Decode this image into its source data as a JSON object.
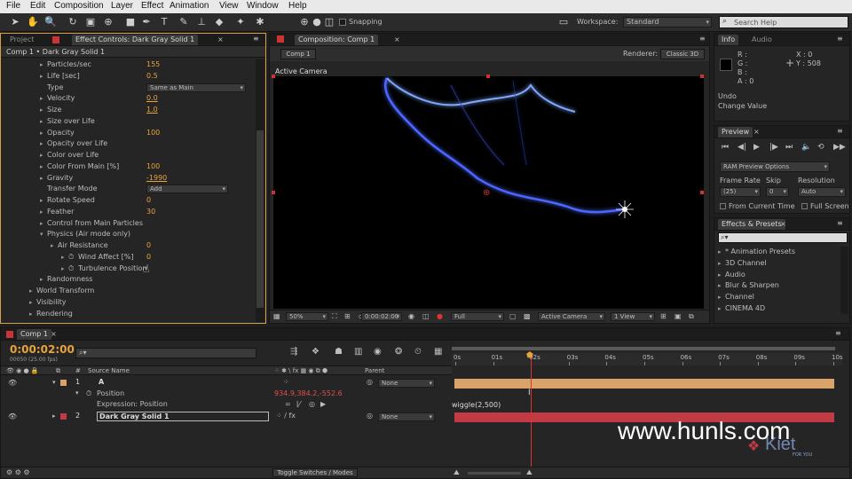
{
  "menu": [
    "File",
    "Edit",
    "Composition",
    "Layer",
    "Effect",
    "Animation",
    "View",
    "Window",
    "Help"
  ],
  "toolbar": {
    "snapping_label": "Snapping",
    "workspace_label": "Workspace:",
    "workspace_value": "Standard",
    "search_placeholder": "Search Help"
  },
  "effect_controls": {
    "tab_project": "Project",
    "tab_effect": "Effect Controls: Dark Gray Solid 1",
    "breadcrumb": "Comp 1 • Dark Gray Solid 1",
    "rows": [
      {
        "label": "Particles/sec",
        "value": "155",
        "indent": 1,
        "twirl": "▸"
      },
      {
        "label": "Life [sec]",
        "value": "0.5",
        "indent": 1,
        "twirl": "▸"
      },
      {
        "label": "Type",
        "value": "",
        "indent": 1,
        "twirl": "",
        "dropdown": "Same as Main"
      },
      {
        "label": "Velocity",
        "value": "0.0",
        "indent": 1,
        "twirl": "▸",
        "under": true
      },
      {
        "label": "Size",
        "value": "1.0",
        "indent": 1,
        "twirl": "▸",
        "under": true
      },
      {
        "label": "Size over Life",
        "value": "",
        "indent": 1,
        "twirl": "▸"
      },
      {
        "label": "Opacity",
        "value": "100",
        "indent": 1,
        "twirl": "▸"
      },
      {
        "label": "Opacity over Life",
        "value": "",
        "indent": 1,
        "twirl": "▸"
      },
      {
        "label": "Color over Life",
        "value": "",
        "indent": 1,
        "twirl": "▸"
      },
      {
        "label": "Color From Main [%]",
        "value": "100",
        "indent": 1,
        "twirl": "▸"
      },
      {
        "label": "Gravity",
        "value": "-1990",
        "indent": 1,
        "twirl": "▸",
        "under": true
      },
      {
        "label": "Transfer Mode",
        "value": "",
        "indent": 1,
        "twirl": "",
        "dropdown": "Add"
      },
      {
        "label": "Rotate Speed",
        "value": "0",
        "indent": 1,
        "twirl": "▸"
      },
      {
        "label": "Feather",
        "value": "30",
        "indent": 1,
        "twirl": "▸"
      },
      {
        "label": "Control from Main Particles",
        "value": "",
        "indent": 1,
        "twirl": "▸"
      },
      {
        "label": "Physics (Air mode only)",
        "value": "",
        "indent": 1,
        "twirl": "▾"
      },
      {
        "label": "Air Resistance",
        "value": "0",
        "indent": 2,
        "twirl": "▸"
      },
      {
        "label": "Wind Affect [%]",
        "value": "0",
        "indent": 3,
        "twirl": "▸",
        "stopwatch": true
      },
      {
        "label": "Turbulence Position",
        "value": "",
        "indent": 3,
        "twirl": "▸",
        "stopwatch": true
      },
      {
        "label": "Randomness",
        "value": "",
        "indent": 1,
        "twirl": "▸"
      },
      {
        "label": "World Transform",
        "value": "",
        "indent": 0,
        "twirl": "▸"
      },
      {
        "label": "Visibility",
        "value": "",
        "indent": 0,
        "twirl": "▸"
      },
      {
        "label": "Rendering",
        "value": "",
        "indent": 0,
        "twirl": "▸"
      }
    ]
  },
  "composition": {
    "tab": "Composition: Comp 1",
    "comp_tab": "Comp 1",
    "renderer_label": "Renderer:",
    "renderer_value": "Classic 3D",
    "view_label": "Active Camera",
    "zoom": "50%",
    "timecode": "0:00:02:00",
    "resolution": "Full",
    "camera": "Active Camera",
    "views": "1 View"
  },
  "info": {
    "tab_info": "Info",
    "tab_audio": "Audio",
    "r": "R :",
    "g": "G :",
    "b": "B :",
    "a": "A : 0",
    "x": "X : 0",
    "y": "Y : 508",
    "undo": "Undo",
    "undo_action": "Change Value"
  },
  "preview": {
    "tab": "Preview",
    "options": "RAM Preview Options",
    "frame_rate_label": "Frame Rate",
    "skip_label": "Skip",
    "resolution_label": "Resolution",
    "frame_rate_value": "(25)",
    "skip_value": "0",
    "resolution_value": "Auto",
    "from_current": "From Current Time",
    "full_screen": "Full Screen"
  },
  "effects_presets": {
    "tab": "Effects & Presets",
    "items": [
      "* Animation Presets",
      "3D Channel",
      "Audio",
      "Blur & Sharpen",
      "Channel",
      "CINEMA 4D"
    ]
  },
  "timeline": {
    "tab": "Comp 1",
    "timecode": "0:00:02:00",
    "frame_info": "00050 (25.00 fps)",
    "col_source": "Source Name",
    "col_parent": "Parent",
    "ruler": [
      "0s",
      "01s",
      "02s",
      "03s",
      "04s",
      "05s",
      "06s",
      "07s",
      "08s",
      "09s",
      "10s"
    ],
    "layers": [
      {
        "num": "1",
        "name": "A",
        "parent": "None",
        "color": "#d9a36a"
      },
      {
        "num": "2",
        "name": "Dark Gray Solid 1",
        "parent": "None",
        "color": "#c23b44"
      }
    ],
    "position_label": "Position",
    "position_value": "934.9,384.2,-552.6",
    "expression_label": "Expression: Position",
    "expression_text": "wiggle(2,500)",
    "toggle_label": "Toggle Switches / Modes"
  },
  "watermark": {
    "site": "www.hunls.com",
    "brand": "Kiet",
    "brand_sub": "FOR YOU"
  }
}
